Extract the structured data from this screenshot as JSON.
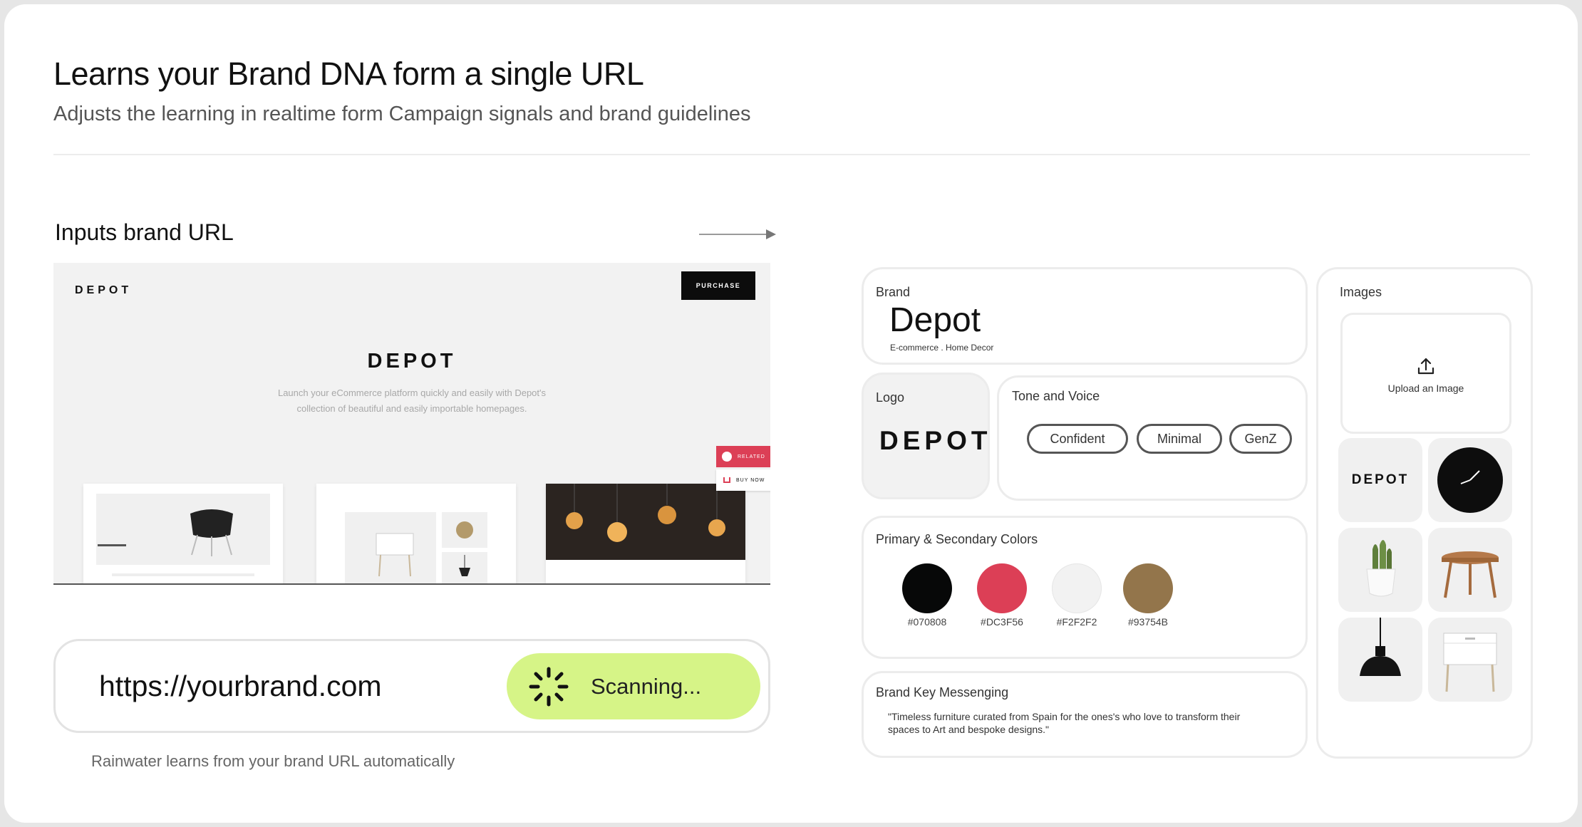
{
  "header": {
    "title": "Learns your Brand DNA form a single URL",
    "subtitle": "Adjusts the learning in realtime form Campaign signals and brand guidelines"
  },
  "inputs": {
    "label": "Inputs brand URL"
  },
  "website_preview": {
    "logo": "DEPOT",
    "purchase_label": "PURCHASE",
    "hero_title": "DEPOT",
    "hero_description": "Launch your eCommerce platform quickly and easily with Depot's collection of beautiful and easily importable homepages.",
    "related_label": "RELATED",
    "buy_now_label": "BUY NOW"
  },
  "url_input": {
    "value": "https://yourbrand.com",
    "scan_label": "Scanning...",
    "hint": "Rainwater learns from your brand URL automatically"
  },
  "brand_card": {
    "label": "Brand",
    "name": "Depot",
    "category": "E-commerce . Home Decor"
  },
  "logo_card": {
    "label": "Logo",
    "logo_text": "DEPOT"
  },
  "tone_card": {
    "label": "Tone and Voice",
    "chips": [
      "Confident",
      "Minimal",
      "GenZ"
    ]
  },
  "colors_card": {
    "label": "Primary & Secondary Colors",
    "colors": [
      {
        "hex": "#070808",
        "label": "#070808"
      },
      {
        "hex": "#DC3F56",
        "label": "#DC3F56"
      },
      {
        "hex": "#F2F2F2",
        "label": "#F2F2F2"
      },
      {
        "hex": "#93754B",
        "label": "#93754B"
      }
    ]
  },
  "messaging_card": {
    "label": "Brand Key Messenging",
    "text": "\"Timeless furniture curated from Spain for the ones's who love to transform their spaces to Art and bespoke designs.\""
  },
  "images_card": {
    "label": "Images",
    "upload_label": "Upload an Image",
    "upload_icon": "upload-icon",
    "tiles": [
      {
        "name": "image-tile-depot-logo",
        "text": "DEPOT"
      },
      {
        "name": "image-tile-wall-clock",
        "text": ""
      },
      {
        "name": "image-tile-cactus-plant",
        "text": ""
      },
      {
        "name": "image-tile-side-table",
        "text": ""
      },
      {
        "name": "image-tile-pendant-lamp",
        "text": ""
      },
      {
        "name": "image-tile-nightstand",
        "text": ""
      }
    ]
  },
  "accent": {
    "scan_button": "#D6F487",
    "related": "#DC3F56"
  }
}
